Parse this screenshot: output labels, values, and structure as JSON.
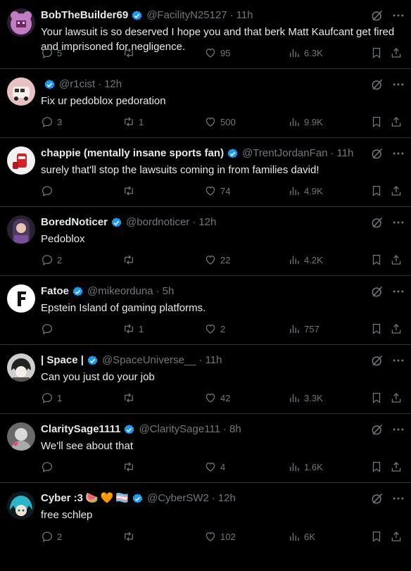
{
  "tweets": [
    {
      "name": "BobTheBuilder69",
      "handle": "@FacilityN25127",
      "dot": "·",
      "time": "11h",
      "text": "Your lawsuit is so deserved I hope you and that berk Matt Kaufcant get fired and imprisoned for negligence.",
      "replies": "5",
      "retweets": "",
      "likes": "95",
      "views": "6.3K",
      "avatar": "pink-bear-avatar",
      "avatarColor": "#c27cc2"
    },
    {
      "name": "",
      "handle": "@r1cist",
      "dot": "·",
      "time": "12h",
      "text": "Fix ur pedoblox pedoration",
      "replies": "3",
      "retweets": "1",
      "likes": "500",
      "views": "9.9K",
      "avatar": "bus-avatar",
      "avatarColor": "#e8c2c2"
    },
    {
      "name": "chappie (mentally insane sports fan)",
      "handle": "@TrentJordanFan",
      "dot": "·",
      "time": "11h",
      "text": "surely that'll stop the lawsuits coming in from families david!",
      "replies": "",
      "retweets": "",
      "likes": "74",
      "views": "4.9K",
      "avatar": "drink-avatar",
      "avatarColor": "#f2f2f2"
    },
    {
      "name": "BoredNoticer",
      "handle": "@bordnoticer",
      "dot": "·",
      "time": "12h",
      "text": "Pedoblox",
      "replies": "2",
      "retweets": "",
      "likes": "22",
      "views": "4.2K",
      "avatar": "purple-girl-avatar",
      "avatarColor": "#4a3b5c"
    },
    {
      "name": "Fatoe",
      "handle": "@mikeorduna",
      "dot": "·",
      "time": "5h",
      "text": "Epstein Island of gaming platforms.",
      "replies": "",
      "retweets": "1",
      "likes": "2",
      "views": "757",
      "avatar": "letter-f-avatar",
      "avatarColor": "#ffffff"
    },
    {
      "name": "| Space |",
      "handle": "@SpaceUniverse__",
      "dot": "·",
      "time": "11h",
      "text": "Can you just do your job",
      "replies": "1",
      "retweets": "",
      "likes": "42",
      "views": "3.3K",
      "avatar": "anime-avatar",
      "avatarColor": "#cfcfcf"
    },
    {
      "name": "ClaritySage1111",
      "handle": "@ClaritySage111",
      "dot": "·",
      "time": "8h",
      "text": "We'll see about that",
      "replies": "",
      "retweets": "",
      "likes": "4",
      "views": "1.6K",
      "avatar": "grey-heart-avatar",
      "avatarColor": "#9a9a9a"
    },
    {
      "name": "Cyber :3",
      "handle": "@CyberSW2",
      "dot": "·",
      "time": "12h",
      "text": "free schlep",
      "replies": "2",
      "retweets": "",
      "likes": "102",
      "views": "6K",
      "avatar": "teal-hair-avatar",
      "avatarColor": "#2bb5c9",
      "emojis": [
        "🍉",
        "🧡",
        "🏳️‍⚧️"
      ]
    }
  ],
  "colors": {
    "background": "#000000",
    "text": "#e7e9ea",
    "muted": "#71767b",
    "divider": "#2f3336",
    "verified": "#1d9bf0"
  },
  "icons": {
    "verified": "verified-badge-icon",
    "grok": "grok-icon",
    "more": "more-icon",
    "reply": "reply-icon",
    "retweet": "retweet-icon",
    "like": "heart-icon",
    "views": "views-icon",
    "bookmark": "bookmark-icon",
    "share": "share-icon"
  }
}
